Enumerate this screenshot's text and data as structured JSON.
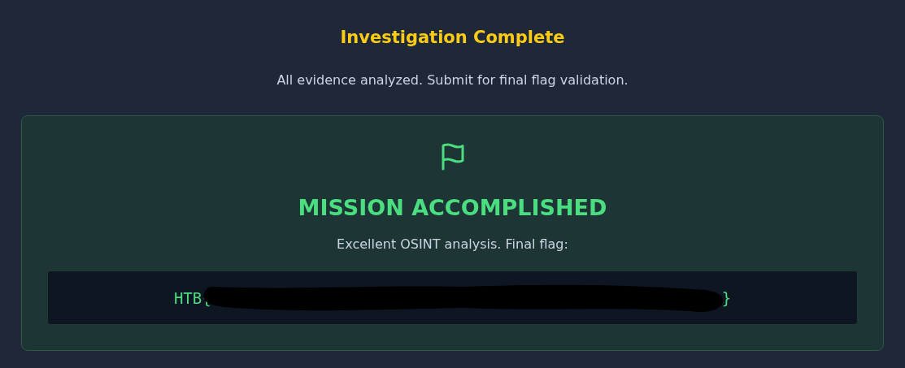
{
  "header": {
    "title": "Investigation Complete",
    "subtitle": "All evidence analyzed. Submit for final flag validation."
  },
  "result_card": {
    "heading": "MISSION ACCOMPLISHED",
    "message": "Excellent OSINT analysis. Final flag:",
    "flag": {
      "prefix": "HTB{",
      "redacted": true,
      "suffix": "}"
    }
  }
}
